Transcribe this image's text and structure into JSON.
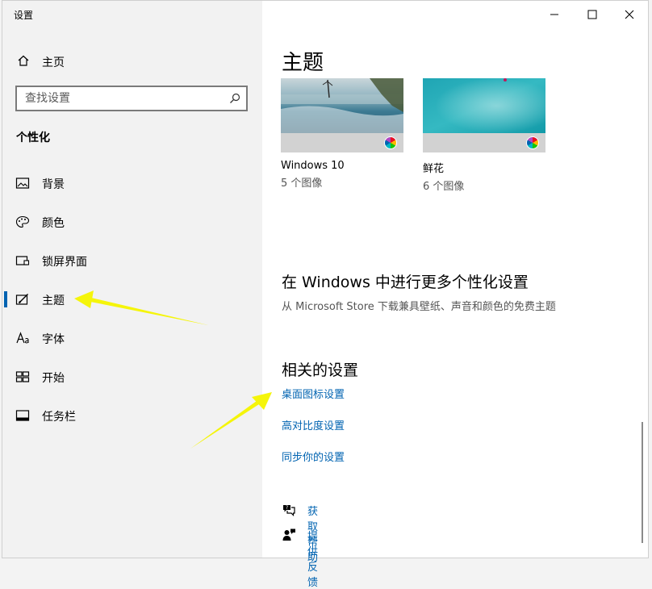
{
  "window": {
    "title": "设置"
  },
  "sidebar": {
    "home_label": "主页",
    "search_placeholder": "查找设置",
    "section_title": "个性化",
    "items": [
      {
        "label": "背景",
        "icon": "picture-icon"
      },
      {
        "label": "颜色",
        "icon": "palette-icon"
      },
      {
        "label": "锁屏界面",
        "icon": "lock-screen-icon"
      },
      {
        "label": "主题",
        "icon": "theme-brush-icon",
        "selected": true
      },
      {
        "label": "字体",
        "icon": "font-icon"
      },
      {
        "label": "开始",
        "icon": "start-grid-icon"
      },
      {
        "label": "任务栏",
        "icon": "taskbar-icon"
      }
    ]
  },
  "main": {
    "page_title": "主题",
    "themes": [
      {
        "name": "Windows 10",
        "count": "5 个图像"
      },
      {
        "name": "鲜花",
        "count": "6 个图像"
      }
    ],
    "more_title": "在 Windows 中进行更多个性化设置",
    "more_subtitle": "从 Microsoft Store 下载兼具壁纸、声音和颜色的免费主题",
    "related_title": "相关的设置",
    "related_links": [
      "桌面图标设置",
      "高对比度设置",
      "同步你的设置"
    ],
    "help_links": [
      {
        "label": "获取帮助",
        "icon": "help-chat-icon"
      },
      {
        "label": "提供反馈",
        "icon": "feedback-person-icon"
      }
    ]
  },
  "colors": {
    "accent": "#0063b1",
    "sidebar_bg": "#f2f2f2",
    "annotation_arrow": "#f5f50a"
  }
}
